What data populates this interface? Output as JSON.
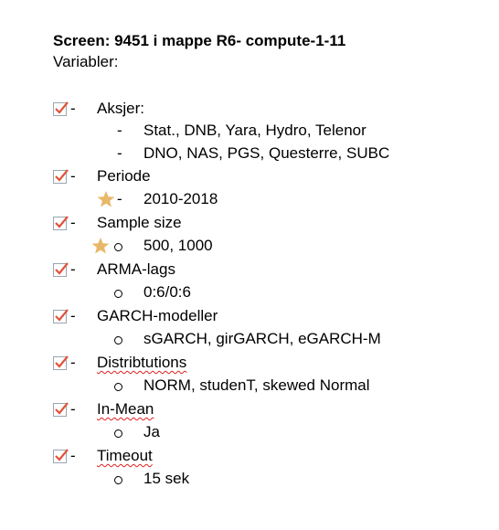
{
  "header": {
    "title": "Screen: 9451 i mappe R6- compute-1-11",
    "subtitle": "Variabler:"
  },
  "colors": {
    "check_mark": "#e0533a",
    "check_border": "#9aa6b2",
    "star": "#e8b86a",
    "spellcheck": "#e02020"
  },
  "items": [
    {
      "label": "Aksjer:",
      "sub": [
        "Stat., DNB, Yara, Hydro, Telenor",
        "DNO, NAS, PGS, Questerre, SUBC"
      ]
    },
    {
      "label": "Periode",
      "sub": [
        "2010-2018"
      ]
    },
    {
      "label": "Sample size",
      "sub": [
        "500, 1000"
      ]
    },
    {
      "label": "ARMA-lags",
      "sub": [
        "0:6/0:6"
      ]
    },
    {
      "label": "GARCH-modeller",
      "sub": [
        "sGARCH, girGARCH, eGARCH-M"
      ]
    },
    {
      "label": "Distribtutions",
      "sub": [
        "NORM, studenT, skewed Normal"
      ]
    },
    {
      "label": "In-Mean",
      "sub": [
        "Ja"
      ]
    },
    {
      "label": "Timeout",
      "sub": [
        "15 sek"
      ]
    }
  ]
}
